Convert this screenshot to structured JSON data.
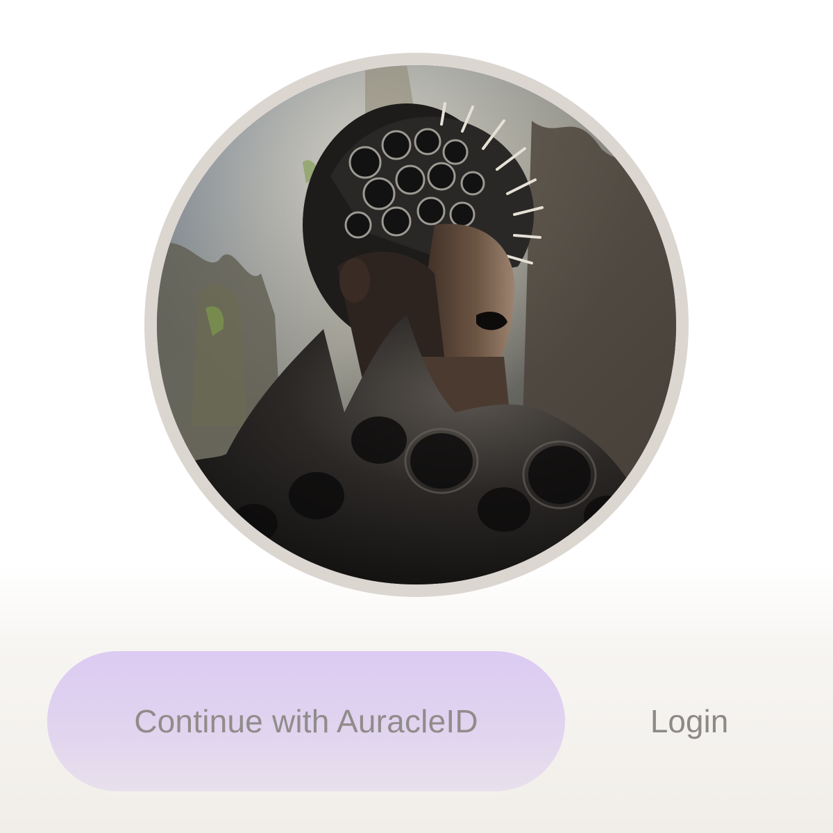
{
  "avatar": {
    "icon": "avatar-portrait",
    "ring_color": "#dcd6d1"
  },
  "actions": {
    "continue_label": "Continue with AuracleID",
    "login_label": "Login"
  },
  "colors": {
    "continue_bg_top": "#dccbf2",
    "continue_bg_bottom": "#e8e0ec",
    "text_muted": "#8f8c8a"
  }
}
